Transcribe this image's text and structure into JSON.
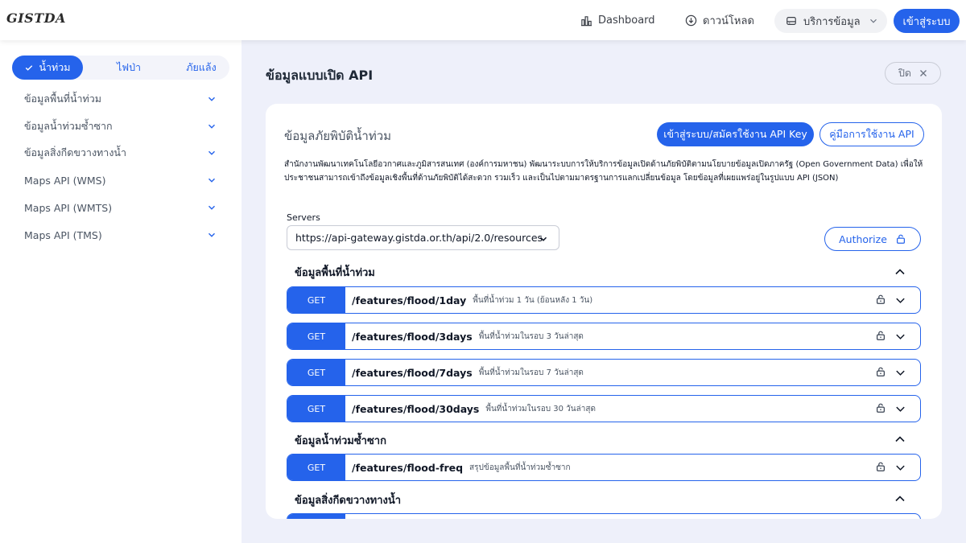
{
  "header": {
    "logo": "GISTDA",
    "nav": [
      {
        "label": "Dashboard",
        "icon": "dashboard-icon"
      },
      {
        "label": "ดาวน์โหลด",
        "icon": "download-icon"
      }
    ],
    "service_menu": {
      "label": "บริการข้อมูล",
      "icon": "server-icon"
    },
    "login_label": "เข้าสู่ระบบ"
  },
  "sidebar": {
    "segments": [
      "น้ำท่วม",
      "ไฟป่า",
      "ภัยแล้ง"
    ],
    "active_segment": "น้ำท่วม",
    "items": [
      {
        "label": "ข้อมูลพื้นที่น้ำท่วม"
      },
      {
        "label": "ข้อมูลน้ำท่วมซ้ำซาก"
      },
      {
        "label": "ข้อมูลสิ่งกีดขวางทางน้ำ"
      },
      {
        "label": "Maps API (WMS)"
      },
      {
        "label": "Maps API (WMTS)"
      },
      {
        "label": "Maps API (TMS)"
      }
    ]
  },
  "main": {
    "title": "ข้อมูลแบบเปิด API",
    "close_label": "ปิด"
  },
  "card": {
    "title": "ข้อมูลภัยพิบัติน้ำท่วม",
    "apikey_label": "เข้าสู่ระบบ/สมัครใช้งาน API Key",
    "manual_label": "คู่มือการใช้งาน API",
    "description": "สำนักงานพัฒนาเทคโนโลยีอวกาศและภูมิสารสนเทศ (องค์การมหาชน) พัฒนาระบบการให้บริการข้อมูลเปิดด้านภัยพิบัติตามนโยบายข้อมูลเปิดภาครัฐ (Open Government Data) เพื่อให้ประชาชนสามารถเข้าถึงข้อมูลเชิงพื้นที่ด้านภัยพิบัติได้สะดวก รวมเร็ว และเป็นไปตามมาตรฐานการแลกเปลี่ยนข้อมูล โดยข้อมูลที่เผยแพร่อยู่ในรูปแบบ API (JSON)",
    "servers_label": "Servers",
    "server_url": "https://api-gateway.gistda.or.th/api/2.0/resources",
    "authorize_label": "Authorize"
  },
  "groups": [
    {
      "title": "ข้อมูลพื้นที่น้ำท่วม",
      "ops": [
        {
          "method": "GET",
          "path": "/features/flood/1day",
          "summary": "พื้นที่น้ำท่วม 1 วัน (ย้อนหลัง 1 วัน)"
        },
        {
          "method": "GET",
          "path": "/features/flood/3days",
          "summary": "พื้นที่น้ำท่วมในรอบ 3 วันล่าสุด"
        },
        {
          "method": "GET",
          "path": "/features/flood/7days",
          "summary": "พื้นที่น้ำท่วมในรอบ 7 วันล่าสุด"
        },
        {
          "method": "GET",
          "path": "/features/flood/30days",
          "summary": "พื้นที่น้ำท่วมในรอบ 30 วันล่าสุด"
        }
      ]
    },
    {
      "title": "ข้อมูลน้ำท่วมซ้ำซาก",
      "ops": [
        {
          "method": "GET",
          "path": "/features/flood-freq",
          "summary": "สรุปข้อมูลพื้นที่น้ำท่วมซ้ำซาก"
        }
      ]
    },
    {
      "title": "ข้อมูลสิ่งกีดขวางทางน้ำ",
      "ops": []
    }
  ],
  "colors": {
    "accent": "#2563eb",
    "background": "#eef0fa"
  }
}
